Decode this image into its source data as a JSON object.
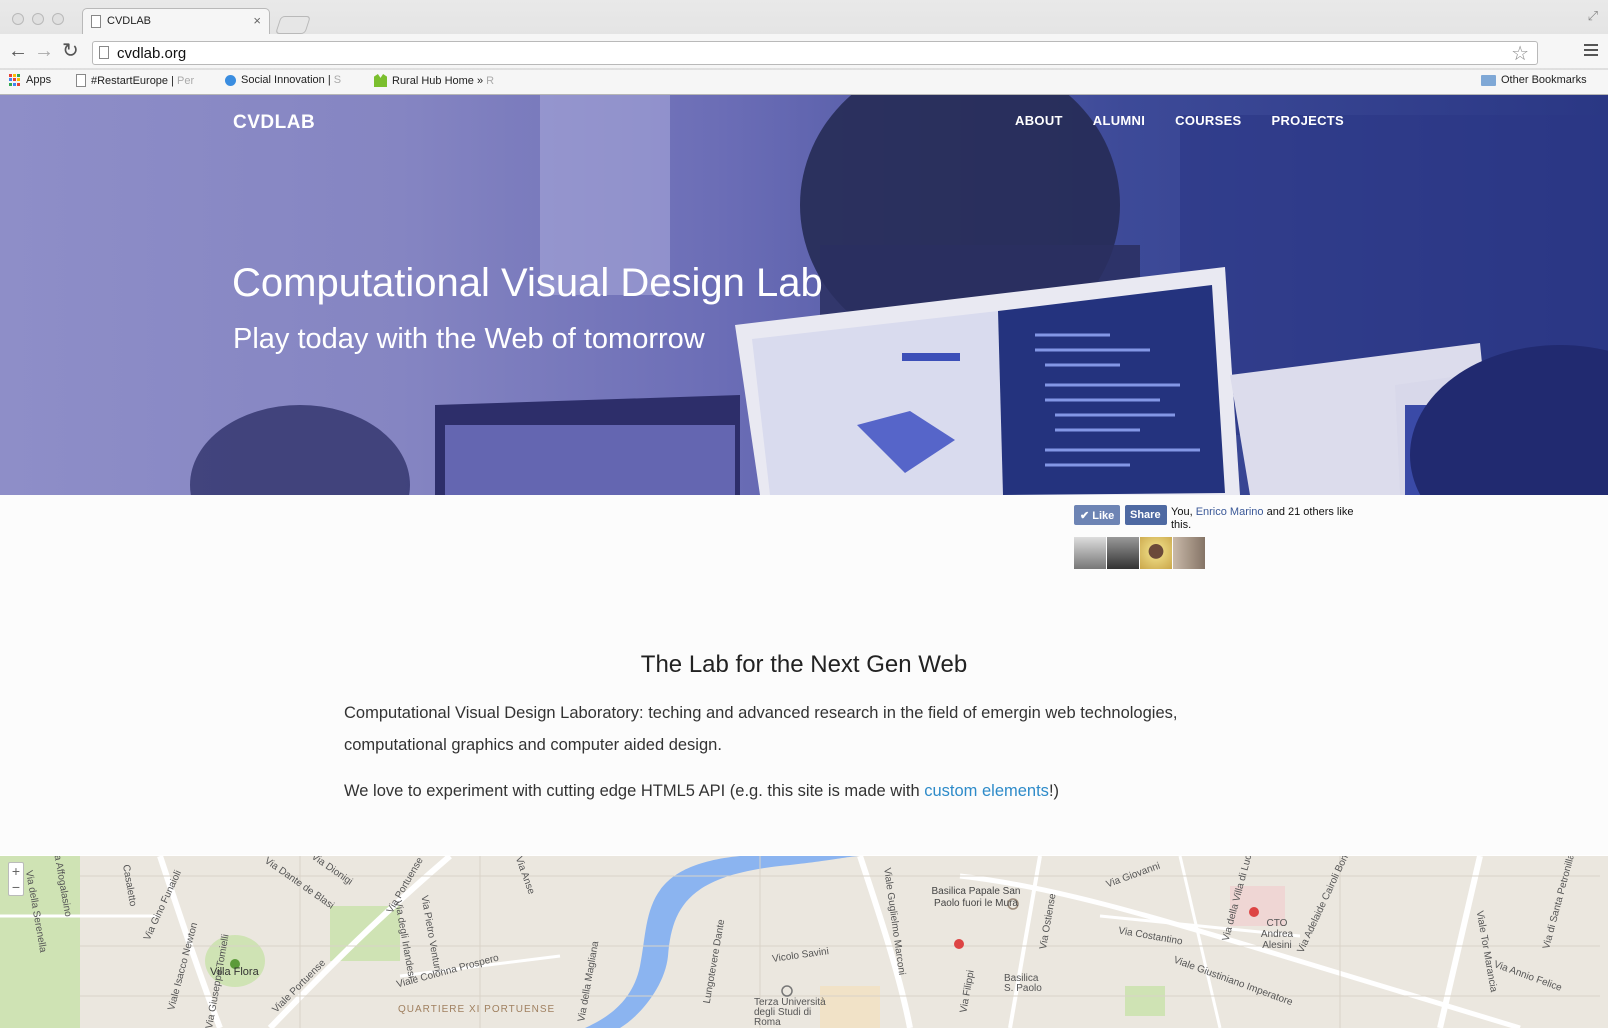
{
  "browser": {
    "tab_title": "CVDLAB",
    "tab_close": "×",
    "url": "cvdlab.org",
    "bookmarks": [
      {
        "label": "Apps",
        "tail": ""
      },
      {
        "label": "#RestartEurope | ",
        "tail": "Per"
      },
      {
        "label": "Social Innovation | ",
        "tail": "S"
      },
      {
        "label": "Rural Hub Home » ",
        "tail": "R"
      }
    ],
    "other_bookmarks": "Other Bookmarks"
  },
  "site": {
    "logo": "CVDLAB",
    "nav": [
      "ABOUT",
      "ALUMNI",
      "COURSES",
      "PROJECTS"
    ],
    "hero_title": "Computational Visual Design Lab",
    "hero_subtitle": "Play today with the Web of tomorrow"
  },
  "facebook": {
    "like": "✔ Like",
    "share": "Share",
    "text_prefix": "You, ",
    "text_link": "Enrico Marino",
    "text_suffix": " and 21 others like this."
  },
  "content": {
    "title": "The Lab for the Next Gen Web",
    "para1": "Computational Visual Design Laboratory: teching and advanced research in the field of emergin web technologies, computational graphics and computer aided design.",
    "para2_prefix": "We love to experiment with cutting edge HTML5 API (e.g. this site is made with ",
    "para2_link": "custom elements",
    "para2_suffix": "!)"
  },
  "map": {
    "zoom_in": "+",
    "zoom_out": "−",
    "labels": [
      "Via Affogalasino",
      "Via della Serenella",
      "Casaletto",
      "Via Gino Funaioli",
      "Viale Isacco Newton",
      "Via Giuseppe Tomielli",
      "Villa Flora",
      "Viale Portuense",
      "Via Dante de Blasi",
      "Via Dionigi",
      "Via Portuense",
      "Via Pietro Venturi",
      "Via degli Irlandesi",
      "Viale Colonna Prospero",
      "QUARTIERE XI PORTUENSE",
      "Via della Magliana",
      "Lungotevere Dante",
      "Vicolo Savini",
      "Terza Università degli Studi di Roma",
      "Viale Guglielmo Marconi",
      "Basilica Papale San Paolo fuori le Mura",
      "Via Ostiense",
      "Via Filippi",
      "Basilica S. Paolo",
      "Via Costantino",
      "Via Giovanni",
      "Via della Villa di Lucina",
      "CTO Andrea Alesini",
      "Via Adelaide Cairoli Bono",
      "Viale Giustiniano Imperatore",
      "Viale Tor Marancia",
      "Via Annio Felice",
      "Via di Santa Petronilla",
      "Via Anse"
    ]
  },
  "colors": {
    "hero_start": "#8e8ec8",
    "hero_end": "#2a3784",
    "link": "#2e8bc9",
    "fb_blue": "#4e69a2",
    "map_bg": "#ebe7df",
    "river": "#8bb4f0"
  }
}
